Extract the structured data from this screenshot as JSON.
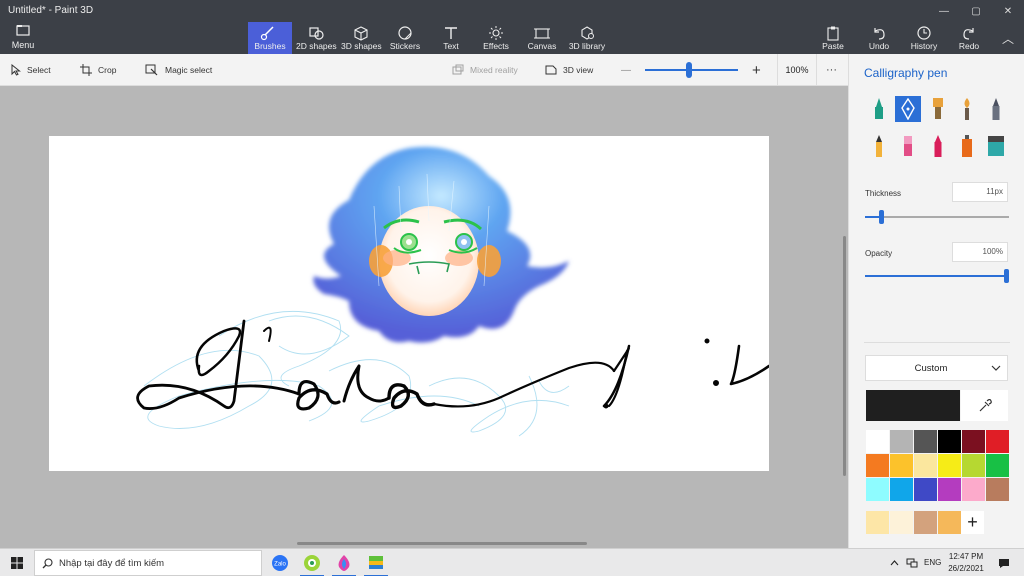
{
  "window": {
    "title": "Untitled* - Paint 3D",
    "minimize_glyph": "—",
    "maximize_glyph": "▢",
    "close_glyph": "✕"
  },
  "ribbon": {
    "menu_label": "Menu",
    "tools": [
      {
        "label": "Brushes",
        "icon": "brush-icon",
        "active": true
      },
      {
        "label": "2D shapes",
        "icon": "shapes-2d-icon"
      },
      {
        "label": "3D shapes",
        "icon": "cube-icon"
      },
      {
        "label": "Stickers",
        "icon": "sticker-icon"
      },
      {
        "label": "Text",
        "icon": "text-icon"
      },
      {
        "label": "Effects",
        "icon": "effects-icon"
      },
      {
        "label": "Canvas",
        "icon": "canvas-icon"
      },
      {
        "label": "3D library",
        "icon": "library-icon"
      }
    ],
    "actions": [
      {
        "label": "Paste",
        "icon": "paste-icon"
      },
      {
        "label": "Undo",
        "icon": "undo-icon"
      },
      {
        "label": "History",
        "icon": "history-icon"
      },
      {
        "label": "Redo",
        "icon": "redo-icon"
      }
    ],
    "collapse_glyph": "︿"
  },
  "subtoolbar": {
    "select": "Select",
    "crop": "Crop",
    "magic_select": "Magic select",
    "mixed_reality": "Mixed reality",
    "view_3d": "3D view",
    "zoom_out_glyph": "—",
    "zoom_in_glyph": "+",
    "zoom_value": "100%",
    "zoom_level": 0.47,
    "more_glyph": "···"
  },
  "panel": {
    "title": "Calligraphy pen",
    "brushes": [
      {
        "name": "marker",
        "color": "#1e9e86",
        "active": false
      },
      {
        "name": "calligraphy-pen",
        "color": "#ffffff",
        "active": true
      },
      {
        "name": "oil-brush",
        "color": "#e8a13a",
        "active": false
      },
      {
        "name": "watercolor",
        "color": "#e8a13a",
        "active": false
      },
      {
        "name": "pixel-pen",
        "color": "#6a7180",
        "active": false
      },
      {
        "name": "pencil",
        "color": "#d88a2a",
        "active": false
      },
      {
        "name": "eraser",
        "color": "#e24d86",
        "active": false
      },
      {
        "name": "crayon",
        "color": "#d91e5a",
        "active": false
      },
      {
        "name": "spray-can",
        "color": "#e86a1a",
        "active": false
      },
      {
        "name": "fill",
        "color": "#2ea8a8",
        "active": false
      }
    ],
    "thickness_label": "Thickness",
    "thickness_value": "11px",
    "thickness_level": 0.11,
    "opacity_label": "Opacity",
    "opacity_value": "100%",
    "opacity_level": 1.0,
    "color_mode": "Custom",
    "current_color": "#1f1f1f",
    "palette": [
      "#ffffff",
      "#b4b4b4",
      "#555555",
      "#000000",
      "#7b1020",
      "#e01e26",
      "#f47a20",
      "#fcc22b",
      "#fbe79e",
      "#f6ec17",
      "#b6d831",
      "#18c045",
      "#8efcff",
      "#10a6ea",
      "#3f49c6",
      "#b43cbf",
      "#fcaacb",
      "#b87c5e"
    ],
    "custom_colors": [
      "#fde6a7",
      "#fdf2d9",
      "#d3a27d",
      "#f5b85a"
    ],
    "add_glyph": "+"
  },
  "taskbar": {
    "search_placeholder": "Nhập tại đây để tìm kiếm",
    "apps": [
      "zalo-icon",
      "coccoc-icon",
      "paint3d-icon",
      "bluestacks-icon"
    ],
    "lang": "ENG",
    "time": "12:47 PM",
    "date": "26/2/2021"
  }
}
